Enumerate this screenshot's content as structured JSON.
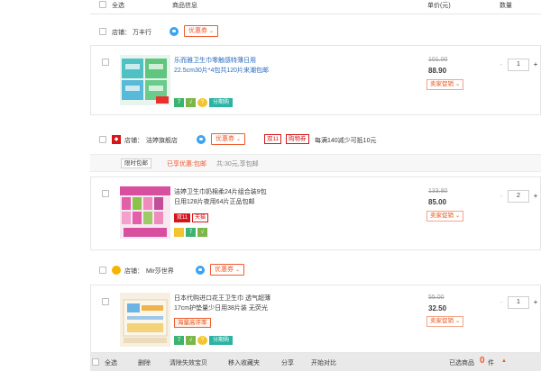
{
  "header": {
    "select_all": "全选",
    "product_info": "商品信息",
    "unit_price": "单价(元)",
    "quantity": "数量"
  },
  "shops": [
    {
      "name_label": "店铺：",
      "name": "万丰行",
      "coupon": "优惠券",
      "items": [
        {
          "title_line1": "乐而雅卫生巾零触感特薄日用",
          "title_line2": "22.5cm30片*4包共120片来潮包邮",
          "original_price": "101.00",
          "current_price": "88.90",
          "promo": "卖家促销",
          "quantity": "1",
          "tags": [
            "7",
            "√",
            "?",
            "分期购"
          ]
        }
      ]
    },
    {
      "name_label": "店铺：",
      "name": "洁婷旗舰店",
      "coupon": "优惠券",
      "promo_tags": [
        "双11",
        "购物券"
      ],
      "promo_desc": "每满140减少可抵10元",
      "sub_tags": [
        "限时包邮"
      ],
      "sub_desc_highlight": "已享优惠:包邮",
      "sub_desc": "共:30元,享包邮",
      "items": [
        {
          "title_line1": "洁婷卫生巾奶棉柔24片组合装9包",
          "title_line2": "日用128片夜用64片正品包邮",
          "original_price": "133.80",
          "current_price": "85.00",
          "promo": "卖家促销",
          "quantity": "2",
          "tags": [
            "双11",
            "天猫",
            "7",
            "√"
          ]
        }
      ]
    },
    {
      "name_label": "店铺：",
      "name": "Mir莎世界",
      "coupon": "优惠券",
      "items": [
        {
          "title_line1": "日本代购进口花王卫生巾 透气超薄",
          "title_line2": "17cm护垫量少日用38片装 无荧光",
          "original_price": "55.00",
          "current_price": "32.50",
          "promo": "卖家促销",
          "quantity": "1",
          "badge_text": "海量高评率",
          "tags": [
            "7",
            "√",
            "?",
            "分期购"
          ]
        }
      ]
    }
  ],
  "footer": {
    "select_all": "全选",
    "delete": "删除",
    "clear_invalid": "清除失效宝贝",
    "move_to_favorites": "移入收藏夹",
    "share": "分享",
    "expand_collapse": "开始对比",
    "selected_label": "已选商品",
    "selected_count": "0",
    "selected_unit": "件",
    "arrow": "▲"
  },
  "colors": {
    "accent": "#f05b2f",
    "promo_text": "#e4541a",
    "shop_badge_red": "#d4161b"
  }
}
